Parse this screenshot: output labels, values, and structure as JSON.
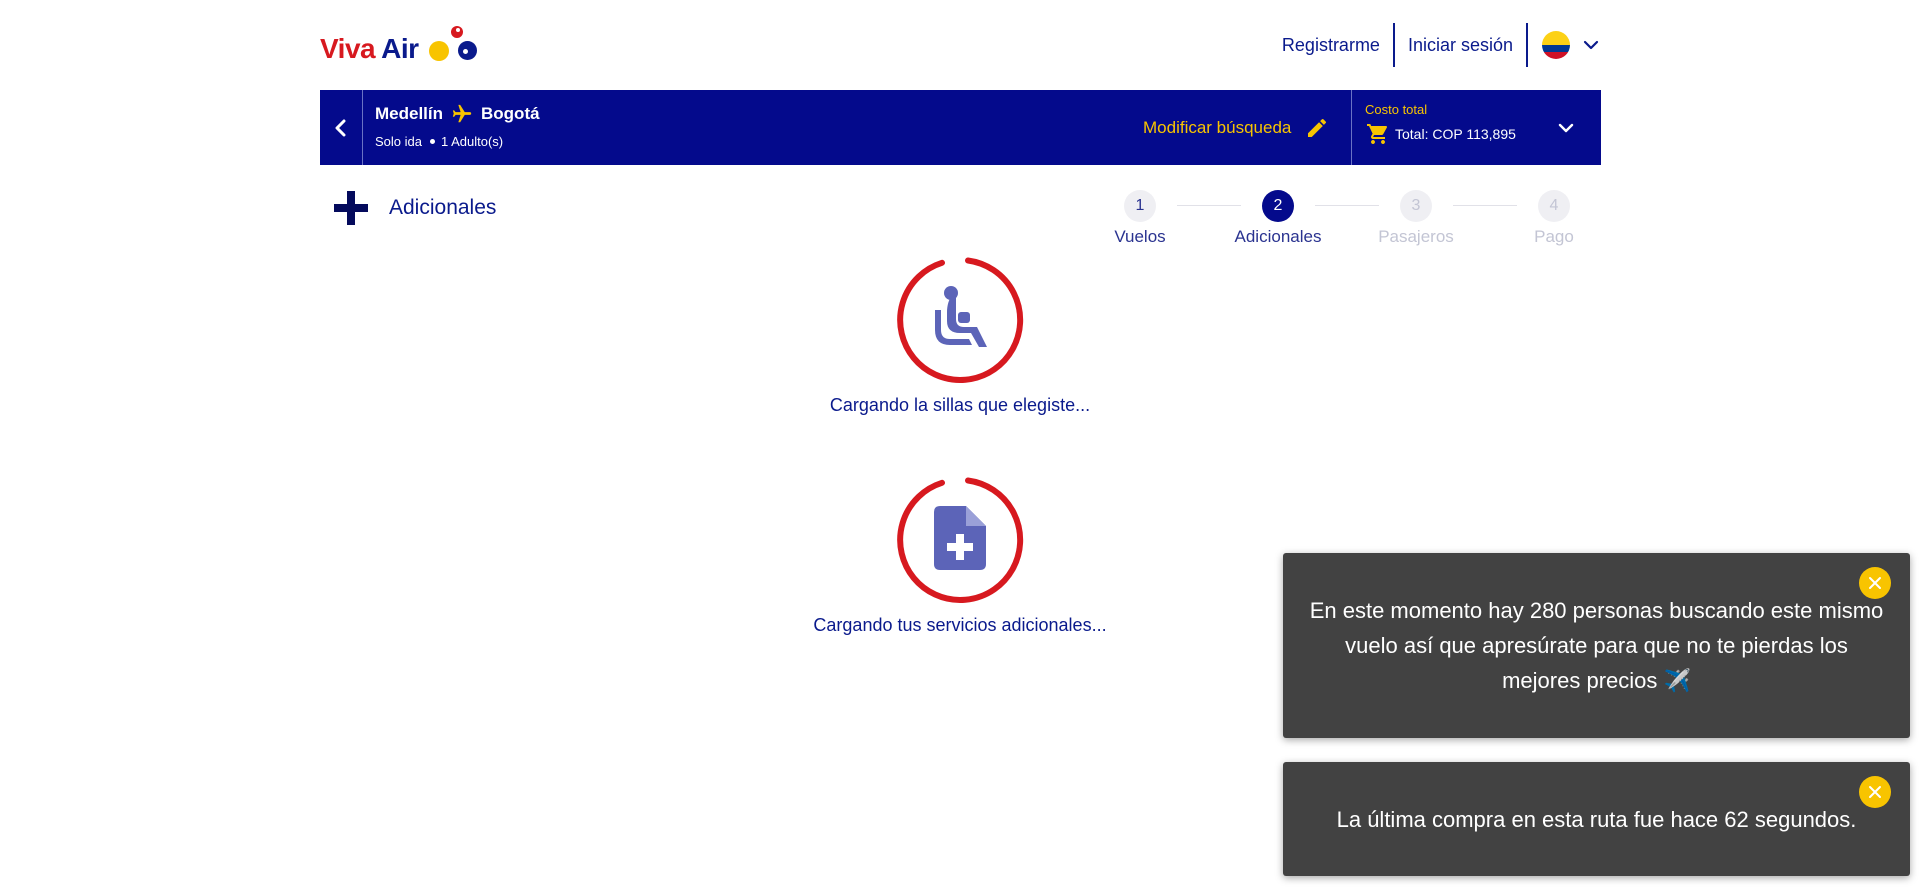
{
  "header": {
    "logo": {
      "word1": "Viva",
      "word2": "Air"
    },
    "register_label": "Registrarme",
    "login_label": "Iniciar sesión",
    "country_flag": "colombia-flag-icon"
  },
  "search_bar": {
    "origin": "Medellín",
    "destination": "Bogotá",
    "trip_type": "Solo ida",
    "passengers": "1 Adulto(s)",
    "modify_label": "Modificar búsqueda",
    "cost_label": "Costo total",
    "total_text": "Total: COP 113,895"
  },
  "section": {
    "title": "Adicionales"
  },
  "stepper": {
    "steps": [
      {
        "number": "1",
        "label": "Vuelos",
        "state": "done"
      },
      {
        "number": "2",
        "label": "Adicionales",
        "state": "active"
      },
      {
        "number": "3",
        "label": "Pasajeros",
        "state": "pending"
      },
      {
        "number": "4",
        "label": "Pago",
        "state": "pending"
      }
    ]
  },
  "loaders": [
    {
      "icon": "seat-icon",
      "text": "Cargando la sillas que elegiste..."
    },
    {
      "icon": "add-document-icon",
      "text": "Cargando tus servicios adicionales..."
    }
  ],
  "toasts": [
    {
      "text": "En este momento hay 280 personas buscando este mismo vuelo así que apresúrate para que no te pierdas los mejores precios ✈️"
    },
    {
      "text": "La última compra en esta ruta fue hace 62 segundos."
    }
  ],
  "colors": {
    "brand_blue": "#040a8c",
    "brand_yellow": "#f8c400",
    "brand_red": "#d7191f",
    "icon_purple": "#5c64b8",
    "toast_bg": "#424242"
  }
}
